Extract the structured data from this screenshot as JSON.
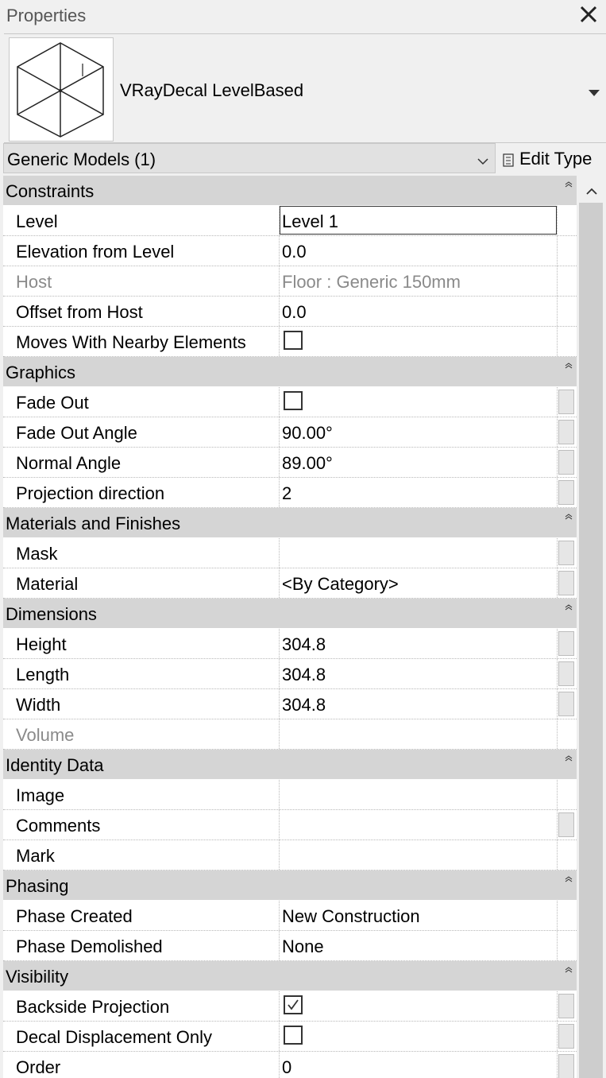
{
  "titlebar": {
    "title": "Properties",
    "close_icon": "close-icon"
  },
  "type_selector": {
    "name": "VRayDecal LevelBased",
    "thumbnail_icon": "generic-model-cube-icon"
  },
  "filter": {
    "selected": "Generic Models (1)",
    "edit_type_label": "Edit Type"
  },
  "groups": [
    {
      "name": "Constraints",
      "rows": [
        {
          "name": "Level",
          "value": "Level 1",
          "kind": "text",
          "active": true
        },
        {
          "name": "Elevation from Level",
          "value": "0.0",
          "kind": "text"
        },
        {
          "name": "Host",
          "value": "Floor : Generic 150mm",
          "kind": "text",
          "readonly": true
        },
        {
          "name": "Offset from Host",
          "value": "0.0",
          "kind": "text"
        },
        {
          "name": "Moves With Nearby Elements",
          "value": "",
          "kind": "check",
          "checked": false
        }
      ]
    },
    {
      "name": "Graphics",
      "rows": [
        {
          "name": "Fade Out",
          "value": "",
          "kind": "check",
          "checked": false,
          "assoc": true
        },
        {
          "name": "Fade Out Angle",
          "value": "90.00°",
          "kind": "text",
          "assoc": true
        },
        {
          "name": "Normal Angle",
          "value": "89.00°",
          "kind": "text",
          "assoc": true
        },
        {
          "name": "Projection direction",
          "value": "2",
          "kind": "text",
          "assoc": true
        }
      ]
    },
    {
      "name": "Materials and Finishes",
      "rows": [
        {
          "name": "Mask",
          "value": "",
          "kind": "text",
          "assoc": true
        },
        {
          "name": "Material",
          "value": "<By Category>",
          "kind": "text",
          "assoc": true
        }
      ]
    },
    {
      "name": "Dimensions",
      "rows": [
        {
          "name": "Height",
          "value": "304.8",
          "kind": "text",
          "assoc": true
        },
        {
          "name": "Length",
          "value": "304.8",
          "kind": "text",
          "assoc": true
        },
        {
          "name": "Width",
          "value": "304.8",
          "kind": "text",
          "assoc": true
        },
        {
          "name": "Volume",
          "value": "",
          "kind": "text",
          "readonly": true
        }
      ]
    },
    {
      "name": "Identity Data",
      "rows": [
        {
          "name": "Image",
          "value": "",
          "kind": "text"
        },
        {
          "name": "Comments",
          "value": "",
          "kind": "text",
          "assoc": true
        },
        {
          "name": "Mark",
          "value": "",
          "kind": "text"
        }
      ]
    },
    {
      "name": "Phasing",
      "rows": [
        {
          "name": "Phase Created",
          "value": "New Construction",
          "kind": "text"
        },
        {
          "name": "Phase Demolished",
          "value": "None",
          "kind": "text"
        }
      ]
    },
    {
      "name": "Visibility",
      "rows": [
        {
          "name": "Backside Projection",
          "value": "",
          "kind": "check",
          "checked": true,
          "assoc": true
        },
        {
          "name": "Decal Displacement Only",
          "value": "",
          "kind": "check",
          "checked": false,
          "assoc": true
        },
        {
          "name": "Order",
          "value": "0",
          "kind": "text",
          "assoc": true
        }
      ]
    }
  ]
}
